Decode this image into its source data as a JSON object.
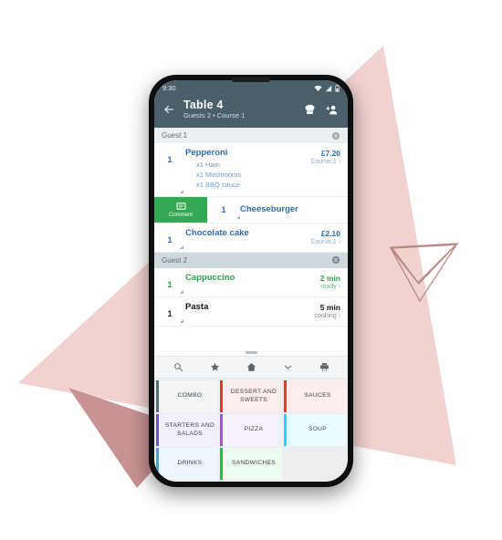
{
  "background": {
    "pink_light": "#f0d2d0",
    "pink_dark": "#c79292",
    "outline": "#b98a85"
  },
  "status_bar": {
    "time": "9:30",
    "icons": [
      "wifi-icon",
      "signal-icon",
      "battery-icon"
    ]
  },
  "app_bar": {
    "back_icon": "arrow-back-icon",
    "title": "Table 4",
    "subtitle": "Guests 2 • Course 1",
    "actions": [
      {
        "name": "chef-hat-icon",
        "label": "Kitchen"
      },
      {
        "name": "add-person-icon",
        "label": "Add guest"
      }
    ]
  },
  "guests": [
    {
      "label": "Guest 1",
      "header_style": "light",
      "clear_icon": "clear-guest-icon",
      "items": [
        {
          "qty": "1",
          "name": "Pepperoni",
          "modifiers": [
            "x1 Ham",
            "x1 Mushrooms",
            "x1 BBQ sauce"
          ],
          "price": "£7.20",
          "status": "Course 1",
          "color": "blue",
          "swiped": false
        },
        {
          "qty": "1",
          "name": "Cheeseburger",
          "modifiers": [],
          "price": "",
          "status": "",
          "color": "blue",
          "swiped": true,
          "swipe_action": {
            "label": "Comment",
            "icon": "comment-icon",
            "color": "#34a853"
          }
        },
        {
          "qty": "1",
          "name": "Chocolate cake",
          "modifiers": [],
          "price": "£2.10",
          "status": "Course 1",
          "color": "blue",
          "swiped": false
        }
      ]
    },
    {
      "label": "Guest 2",
      "header_style": "dark",
      "clear_icon": "clear-guest-icon",
      "items": [
        {
          "qty": "1",
          "name": "Cappuccino",
          "modifiers": [],
          "price": "2 min",
          "status": "ready",
          "color": "green",
          "swiped": false
        },
        {
          "qty": "1",
          "name": "Pasta",
          "modifiers": [],
          "price": "5 min",
          "status": "cooking",
          "color": "dark",
          "swiped": false
        }
      ]
    }
  ],
  "drag_handle": "sheet-drag-handle",
  "toolbar": {
    "buttons": [
      {
        "name": "search-icon",
        "label": "Search"
      },
      {
        "name": "star-icon",
        "label": "Favourites"
      },
      {
        "name": "home-icon",
        "label": "Home"
      },
      {
        "name": "chevron-down-icon",
        "label": "Collapse"
      },
      {
        "name": "print-icon",
        "label": "Print"
      }
    ]
  },
  "categories": [
    {
      "label": "COMBO",
      "accent": "#546e7a",
      "bg": "#f3f5f6"
    },
    {
      "label": "DESSERT AND SWEETS",
      "accent": "#f4352f",
      "bg": "#fdeeee"
    },
    {
      "label": "SAUCES",
      "accent": "#f4352f",
      "bg": "#fdeeee"
    },
    {
      "label": "STARTERS AND SALADS",
      "accent": "#6c4ee0",
      "bg": "#f2f1fb"
    },
    {
      "label": "PIZZA",
      "accent": "#a24fe8",
      "bg": "#f8f0fd"
    },
    {
      "label": "SOUP",
      "accent": "#13dff5",
      "bg": "#ecfdff"
    },
    {
      "label": "DRINKS",
      "accent": "#4d9ee8",
      "bg": "#eef6fd"
    },
    {
      "label": "SANDWICHES",
      "accent": "#16c149",
      "bg": "#eefbf1"
    }
  ]
}
